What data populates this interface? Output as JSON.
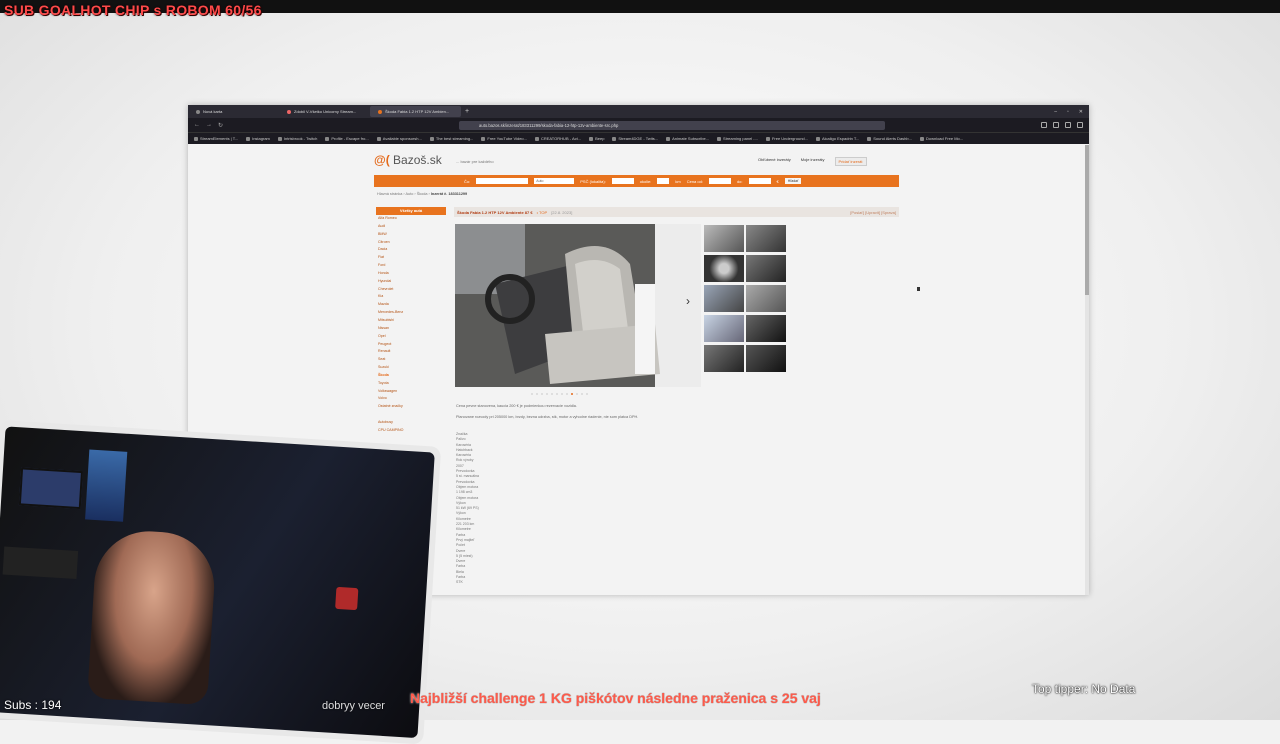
{
  "stream_overlay": {
    "title": "SUB GOALHOT CHIP s ROBOM 60/56",
    "subs": "Subs : 194",
    "ticker": "Najbližší challenge 1 KG piškótov následne praženica s 25 vaj",
    "chat_line": "dobryy vecer",
    "top_tipper": "Top tipper: No Data"
  },
  "browser": {
    "tabs": [
      {
        "label": "Nová karta",
        "active": false
      },
      {
        "label": "Zdobil V-Všetko Unicorny Stream...",
        "active": false
      },
      {
        "label": "Škoda Fabia 1.2 HTP 12V Ambien...",
        "active": true
      }
    ],
    "url": "auto.bazos.sk/inzerat/183311299/skoda-fabia-12-htp-12v-ambiente-src.php",
    "bookmarks": [
      "StreamElements | T...",
      "Instagram",
      "Intrisbrook - Twitch",
      "Profile - Escape fro...",
      "Available sponsorsh...",
      "The best streaming...",
      "Free YouTube Video...",
      "CREATORHUB - Act...",
      "Beep",
      "Stream4DGE - Twits...",
      "Animate Subscribe...",
      "Streaming panel -...",
      "Free Underground...",
      "Alcaligo Espadrin T...",
      "Sound Alerts Dashb...",
      "Download Free Mo..."
    ]
  },
  "bazos": {
    "logo": "Bazoš.sk",
    "tagline": "... bazár pre každého",
    "links": {
      "my_ads": "Obľúbené inzeráty",
      "my_ads2": "Moje inzeráty",
      "add": "Pridať inzerát"
    },
    "search": {
      "what_label": "Čo:",
      "category": "Auto",
      "psc_label": "PSČ (lokalita):",
      "radius_label": "okolie:",
      "radius_unit": "km",
      "price_label": "Cena od:",
      "price_to": "do:",
      "eur": "€",
      "button": "Hľadať"
    },
    "breadcrumb": [
      "Hlavná stránka",
      "Auto",
      "Škoda"
    ],
    "breadcrumb_current": "Inzerát č. 183311299",
    "sidebar_heading": "Všetky autá",
    "sidebar": [
      "Alfa Romeo",
      "Audi",
      "BMW",
      "Citroen",
      "Dacia",
      "Fiat",
      "Ford",
      "Honda",
      "Hyundai",
      "Chevrolet",
      "Kia",
      "Mazda",
      "Mercedes-Benz",
      "Mitsubishi",
      "Nissan",
      "Opel",
      "Peugeot",
      "Renault",
      "Seat",
      "Suzuki",
      "Škoda",
      "Toyota",
      "Volkswagen",
      "Volvo",
      "Ostatné značky",
      "",
      "Autobusy",
      "CPU CAMPINO"
    ],
    "sidebar_current_index": 20,
    "ad": {
      "title": "Škoda Fabia 1.2 HTP 12V Ambiente 87 €",
      "tags": "• TOP",
      "date": "[22.8. 2023]",
      "actions": "[Poslať] [Upravit] [Sprava]"
    },
    "description_1": "Cena pevne stanovena, kaucia 200 € je podmienkou rezervacie vozidla.",
    "description_2": "Planovane rozvody pri 205000 km, brzdy, bezna udrzba, stk, motor a vyhodne riadenie, nie som platca DPH.",
    "specs": [
      "Značka",
      "Palivo",
      "Karoséria",
      "Hatchback",
      "Karoséria",
      "Rok výroby",
      "2007",
      "Prevodovka",
      "5 st. manuálna",
      "Prevodovka",
      "Objem motora",
      "1 198 cm3",
      "Objem motora",
      "Výkon",
      "51 kW (69 PS)",
      "Výkon",
      "Kilometre",
      "221 203 km",
      "Kilometre",
      "Farba",
      "Prvý majiteľ",
      "Počet",
      "Dvere",
      "5 (5 miest)",
      "Dvere",
      "Farba",
      "Biela",
      "Farba",
      "STK"
    ]
  },
  "colors": {
    "bazos_orange": "#e8731e",
    "ticker_red": "#ff5a4a",
    "title_red": "#ff4a4a"
  }
}
